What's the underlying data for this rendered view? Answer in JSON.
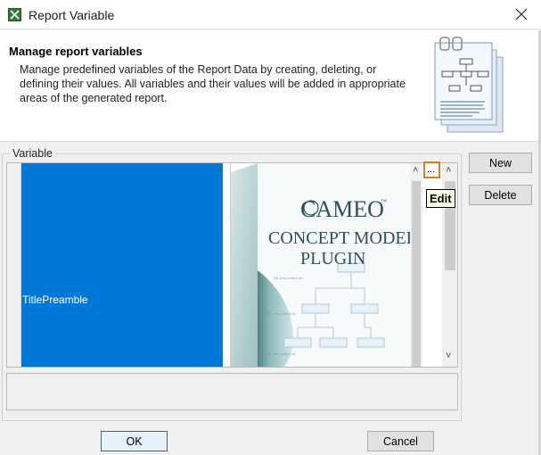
{
  "window": {
    "title": "Report Variable",
    "app_icon": "report-app-icon",
    "close_icon": "close-icon"
  },
  "header": {
    "title": "Manage report variables",
    "description": "Manage predefined variables of the Report Data by creating, deleting, or defining their values. All variables and their values will be added in appropriate areas of the generated report.",
    "illustration": "report-document-icon"
  },
  "variable_group": {
    "legend": "Variable",
    "rows": [
      {
        "name": "TitlePreamble",
        "value_image": "cameo-concept-modeler-plugin-box",
        "value_image_text": [
          "CAMEO",
          "CONCEPT MODELER",
          "PLUGIN"
        ]
      }
    ],
    "edit_button_label": "...",
    "edit_tooltip": "Edit"
  },
  "buttons": {
    "new": "New",
    "delete": "Delete",
    "ok": "OK",
    "cancel": "Cancel"
  },
  "colors": {
    "selection": "#0078d7",
    "edit_highlight": "#e87722",
    "tooltip_bg": "#ffffe1"
  }
}
